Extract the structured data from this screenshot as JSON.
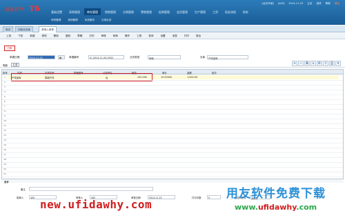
{
  "header": {
    "logo_text": "用友软件",
    "logo_brand": "T6",
    "menu": [
      "基础设置",
      "采购管理",
      "库存管理",
      "销售管理",
      "分销管理",
      "零售管理",
      "促销管理",
      "会员管理",
      "生产管理",
      "工资",
      "现金流程",
      "财务"
    ],
    "submenu": [
      "采购管理",
      "其他管理",
      "系统服务",
      "日常业务"
    ],
    "user": "[北京华诚]",
    "account": "[440]",
    "date": "2014-11-23",
    "links": [
      "主页",
      "选项",
      "帮助"
    ],
    "exit": "退出"
  },
  "tabs": [
    {
      "label": "首页",
      "active": false
    },
    {
      "label": "初始化页面",
      "active": false
    },
    {
      "label": "其他入库单",
      "active": true
    }
  ],
  "menubar": [
    "上张",
    "下张",
    "新增",
    "修改",
    "删除",
    "复制",
    "草稿",
    "打印",
    "审核",
    "转单",
    "操作",
    "工具",
    "查询",
    "设置",
    "消息",
    "打印",
    "退出"
  ],
  "redtag": "已审",
  "form": {
    "date_label": "单据日期",
    "date_value": "2014-11-23",
    "no_label": "单据编号",
    "no_value": "IC-2014-11-00-0002",
    "type_label": "业务类型",
    "type_value": "其他",
    "warehouse_label": "仓库",
    "warehouse_value": "产成品库",
    "gray_value": ""
  },
  "subbar": {
    "label": "明细",
    "button": "汇总"
  },
  "grid": {
    "columns": [
      "存货",
      "存货名称",
      "规格型号",
      "计量单位",
      "数量",
      "单价",
      "金额",
      "批次"
    ],
    "row": {
      "sku": "产成品库",
      "name": "智能开关",
      "unit": "台",
      "qty": "100.000",
      "price": "10.00000",
      "amount": "1,000.00",
      "batch": ""
    },
    "rownums": [
      "1",
      "2",
      "3",
      "4",
      "5",
      "6",
      "7",
      "8",
      "9",
      "10",
      "11",
      "12",
      "13",
      "14",
      "15",
      "16",
      "17",
      "18",
      "19",
      "20",
      "21"
    ]
  },
  "total_label": "合计",
  "bottom": {
    "memo_label": "备注",
    "maker_label": "制单人",
    "maker_value": "400",
    "auditor_label": "审核人",
    "auditor_value": "400",
    "audit_date_label": "审核日期",
    "audit_date_value": "2014-11-23",
    "print_label": "打印次数",
    "print_value": "0",
    "extra_label": "是否有附件",
    "extra_value": "无附件"
  },
  "watermark": {
    "url1": "new.ufidawhy.com",
    "brand": "用友软件免费下载",
    "url2_prefix": "www.",
    "url2_main": "ufidawhy",
    "url2_suffix": ".com"
  }
}
